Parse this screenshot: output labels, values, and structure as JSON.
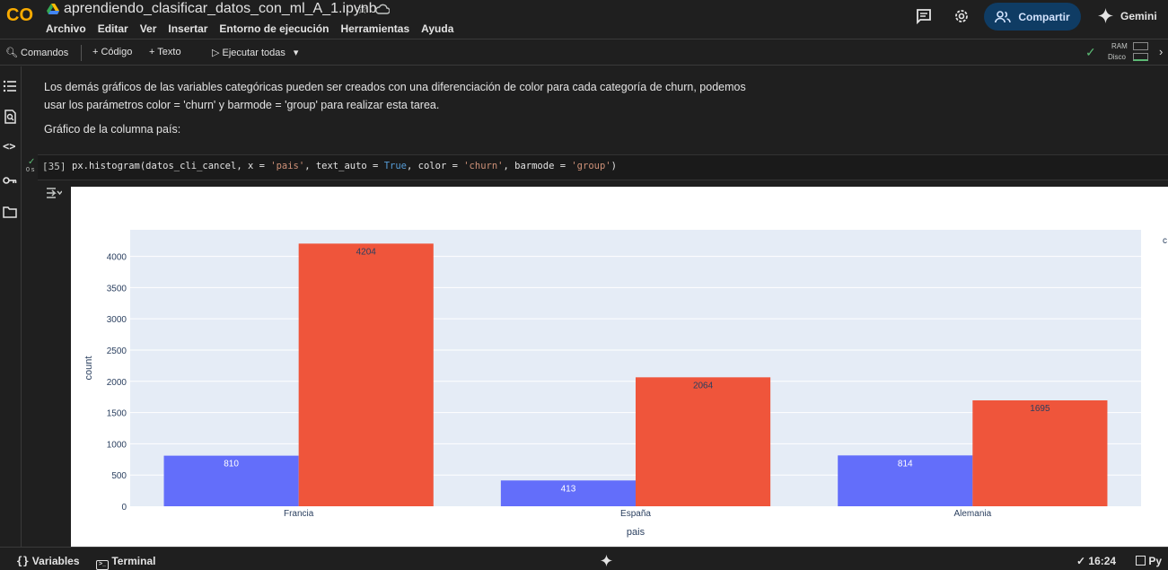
{
  "header": {
    "logo_text": "CO",
    "notebook_title": "aprendiendo_clasificar_datos_con_ml_A_1.ipynb",
    "menu": [
      "Archivo",
      "Editar",
      "Ver",
      "Insertar",
      "Entorno de ejecución",
      "Herramientas",
      "Ayuda"
    ],
    "share_label": "Compartir",
    "gemini_label": "Gemini"
  },
  "toolbar": {
    "commands_label": "Comandos",
    "code_label": "+ Código",
    "text_label": "+ Texto",
    "run_all_label": "Ejecutar todas",
    "ram_label": "RAM",
    "disk_label": "Disco"
  },
  "text_cell": {
    "paragraph_line1": "Los demás gráficos de las variables categóricas pueden ser creados con una diferenciación de color para cada categoría de churn, podemos",
    "paragraph_line2": "usar los parámetros color = 'churn' y barmode = 'group' para realizar esta tarea.",
    "subheading": "Gráfico de la columna país:"
  },
  "code_cell": {
    "exec_count": "[35]",
    "timer": "0 s",
    "code_plain_1": "px.histogram(datos_cli_cancel, x = ",
    "code_str_1": "'pais'",
    "code_plain_2": ", text_auto = ",
    "code_kw": "True",
    "code_plain_3": ", color = ",
    "code_str_2": "'churn'",
    "code_plain_4": ", barmode = ",
    "code_str_3": "'group'",
    "code_plain_5": ")"
  },
  "statusbar": {
    "variables_label": "Variables",
    "terminal_label": "Terminal",
    "time": "16:24",
    "runtime_label": "Py"
  },
  "colors": {
    "series_blue": "#636efa",
    "series_red": "#ef553b",
    "plot_bg": "#e5ecf6",
    "share_bg": "#0f3c64"
  },
  "chart_data": {
    "type": "bar",
    "categories": [
      "Francia",
      "España",
      "Alemania"
    ],
    "series": [
      {
        "values": [
          810,
          413,
          814
        ]
      },
      {
        "values": [
          4204,
          2064,
          1695
        ]
      }
    ],
    "data_labels": [
      [
        "810",
        "413",
        "814"
      ],
      [
        "4204",
        "2064",
        "1695"
      ]
    ],
    "xlabel": "pais",
    "ylabel": "count",
    "yticks": [
      0,
      500,
      1000,
      1500,
      2000,
      2500,
      3000,
      3500,
      4000
    ],
    "ylim": [
      0,
      4425
    ],
    "grid": true,
    "legend_partial_text": "c"
  }
}
